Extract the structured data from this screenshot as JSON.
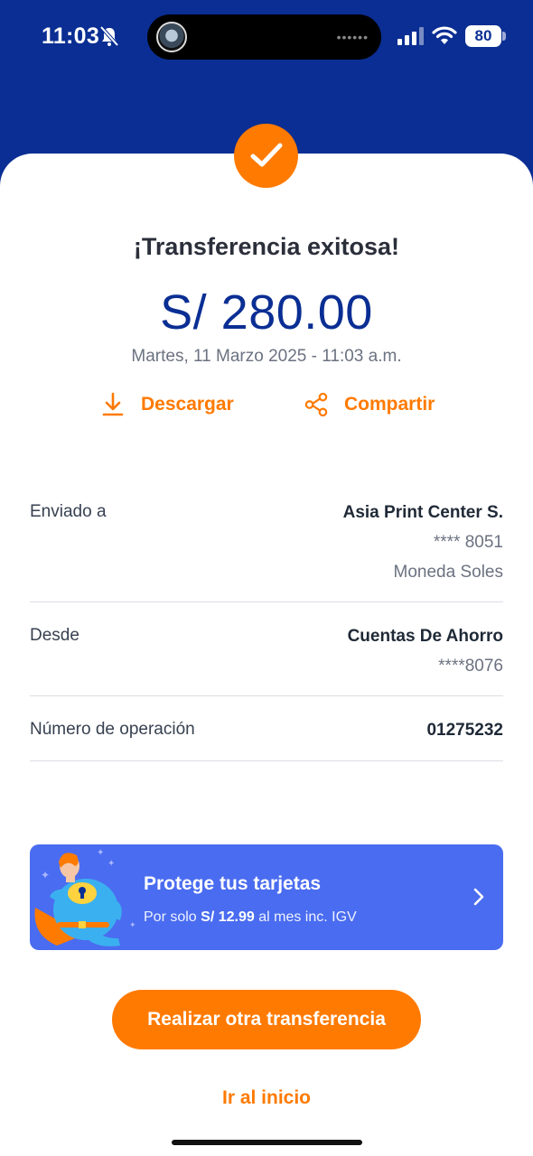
{
  "status_bar": {
    "time": "11:03",
    "battery": "80",
    "icons": [
      "bell-off-icon",
      "signal-icon",
      "wifi-icon",
      "battery-icon"
    ]
  },
  "receipt": {
    "title": "¡Transferencia exitosa!",
    "amount": "S/ 280.00",
    "datetime": "Martes, 11 Marzo 2025 - 11:03 a.m.",
    "actions": {
      "download": "Descargar",
      "share": "Compartir"
    },
    "details": {
      "sent_to": {
        "label": "Enviado a",
        "name": "Asia Print Center S.",
        "account": "**** 8051",
        "currency": "Moneda Soles"
      },
      "from": {
        "label": "Desde",
        "account_type": "Cuentas De Ahorro",
        "account": "****8076"
      },
      "operation": {
        "label": "Número de operación",
        "number": "01275232"
      }
    }
  },
  "promo": {
    "title": "Protege tus tarjetas",
    "sub_prefix": "Por solo",
    "price": "S/ 12.99",
    "sub_suffix": "al mes inc. IGV"
  },
  "buttons": {
    "another_transfer": "Realizar otra transferencia",
    "go_home": "Ir al inicio"
  },
  "colors": {
    "brand_blue": "#0a2e93",
    "accent_orange": "#ff7a00",
    "promo_blue": "#4a6cf0"
  }
}
